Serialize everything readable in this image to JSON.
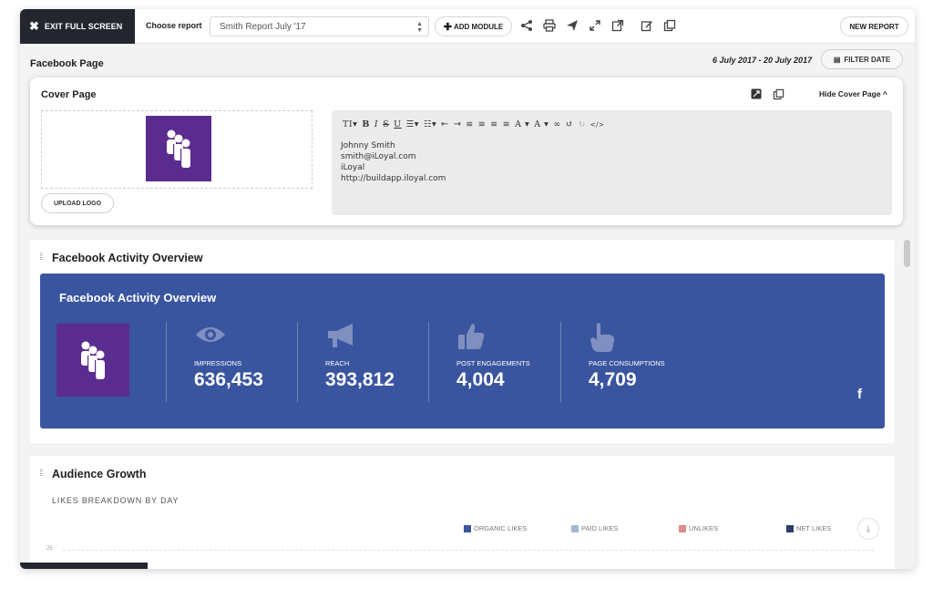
{
  "toolbar": {
    "exit_label": "EXIT FULL SCREEN",
    "choose_label": "Choose report",
    "report_value": "Smith Report July '17",
    "add_module_label": "ADD MODULE",
    "new_report_label": "NEW REPORT",
    "icons": [
      "share-icon",
      "print-icon",
      "send-icon",
      "expand-icon",
      "external-link-icon",
      "edit-icon",
      "copy-icon"
    ]
  },
  "header": {
    "page_title": "Facebook Page",
    "date_range": "6 July 2017 - 20 July 2017",
    "filter_label": "FILTER DATE"
  },
  "cover": {
    "title": "Cover Page",
    "hide_label": "Hide Cover Page",
    "upload_label": "UPLOAD LOGO",
    "editor_lines": [
      "Johnny Smith",
      "smith@iLoyal.com",
      "iLoyal",
      "http://buildapp.iloyal.com"
    ]
  },
  "activity": {
    "section_title": "Facebook Activity Overview",
    "banner_title": "Facebook Activity Overview",
    "metrics": [
      {
        "label": "IMPRESSIONS",
        "value": "636,453",
        "icon": "eye-icon"
      },
      {
        "label": "REACH",
        "value": "393,812",
        "icon": "megaphone-icon"
      },
      {
        "label": "POST ENGAGEMENTS",
        "value": "4,004",
        "icon": "thumbs-up-icon"
      },
      {
        "label": "PAGE CONSUMPTIONS",
        "value": "4,709",
        "icon": "pointer-hand-icon"
      }
    ],
    "brand_color": "#3a559f",
    "logo_color": "#5b2c8f"
  },
  "audience": {
    "section_title": "Audience Growth",
    "subtitle": "LIKES BREAKDOWN BY DAY",
    "legend": [
      {
        "label": "ORGANIC LIKES",
        "color": "#3a559f"
      },
      {
        "label": "PAID LIKES",
        "color": "#a7b4d8"
      },
      {
        "label": "UNLIKES",
        "color": "#e08a8a"
      },
      {
        "label": "NET LIKES",
        "color": "#2c3e66"
      }
    ],
    "y_tick": "25"
  }
}
